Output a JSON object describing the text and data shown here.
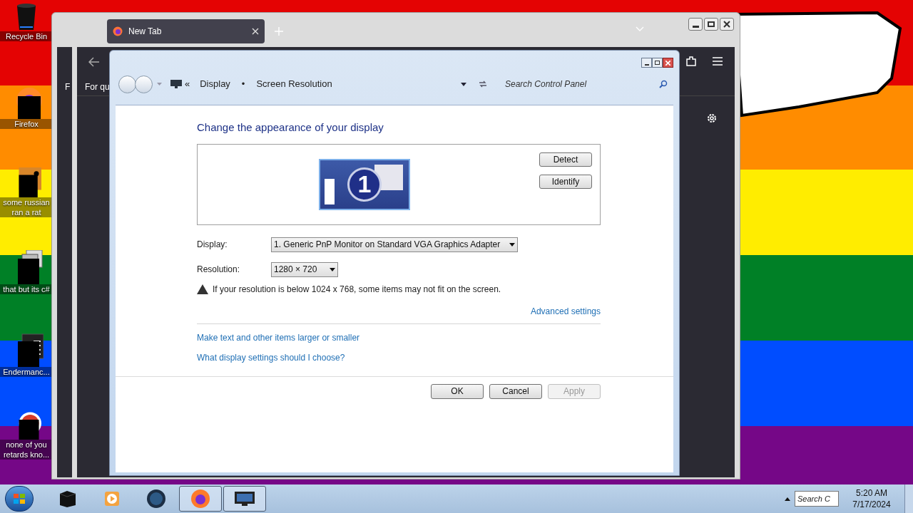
{
  "desktop_icons": [
    {
      "label": "Recycle Bin",
      "kind": "bin"
    },
    {
      "label": "Firefox",
      "kind": "firefox"
    },
    {
      "label": "some russian ran a rat",
      "kind": "app"
    },
    {
      "label": "that but its c#",
      "kind": "stack"
    },
    {
      "label": "Endermanc...",
      "kind": "console"
    },
    {
      "label": "none of you retards kno...",
      "kind": "ring"
    }
  ],
  "browser": {
    "tab": {
      "title": "New Tab"
    },
    "back_bookmark": "F",
    "bookmark": "For qu"
  },
  "dialog": {
    "nav_chevrons": "«",
    "breadcrumb": [
      "Display",
      "Screen Resolution"
    ],
    "breadcrumb_separator": "•",
    "search": {
      "placeholder": "Search Control Panel"
    },
    "heading": "Change the appearance of your display",
    "monitor_number": "1",
    "side_buttons": [
      "Detect",
      "Identify"
    ],
    "fields": [
      {
        "label": "Display:",
        "value": "1. Generic PnP Monitor on Standard VGA Graphics Adapter"
      },
      {
        "label": "Resolution:",
        "value": "1280 × 720"
      }
    ],
    "warning": "If your resolution is below 1024 x 768, some items may not fit on the screen.",
    "advanced_link": "Advanced settings",
    "links": [
      "Make text and other items larger or smaller",
      "What display settings should I choose?"
    ],
    "footer_buttons": [
      {
        "label": "OK",
        "disabled": false
      },
      {
        "label": "Cancel",
        "disabled": false
      },
      {
        "label": "Apply",
        "disabled": true
      }
    ]
  },
  "taskbar": {
    "items": [
      {
        "kind": "box",
        "active": false
      },
      {
        "kind": "media",
        "active": false
      },
      {
        "kind": "globe",
        "active": false
      },
      {
        "kind": "firefox",
        "active": true
      },
      {
        "kind": "monitor",
        "active": true
      }
    ],
    "search": {
      "placeholder": "Search C"
    },
    "time": "5:20 AM",
    "date": "7/17/2024"
  }
}
